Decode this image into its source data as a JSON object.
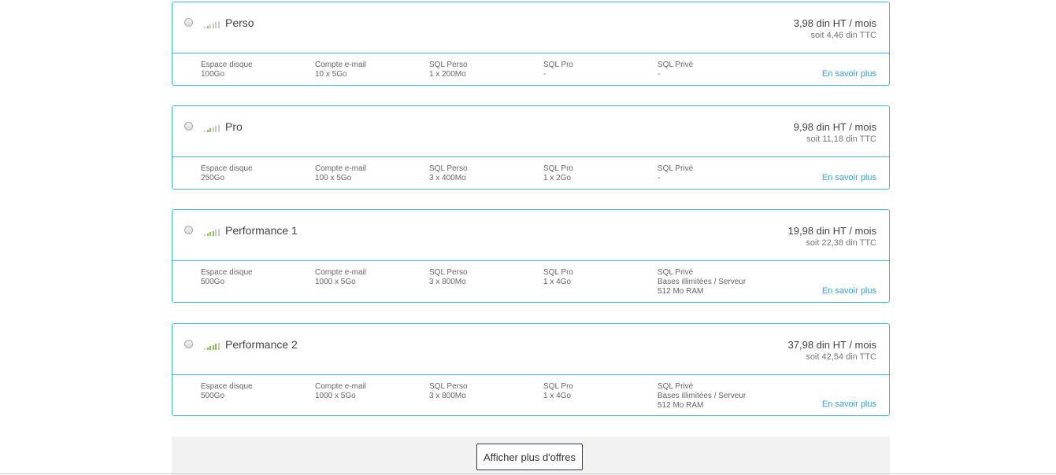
{
  "plans": [
    {
      "name": "Perso",
      "price_ht": "3,98 din HT / mois",
      "price_ttc": "soit 4,46 din TTC",
      "specs": [
        {
          "label": "Espace disque",
          "lines": [
            "100Go"
          ]
        },
        {
          "label": "Compte e-mail",
          "lines": [
            "10 x 5Go"
          ]
        },
        {
          "label": "SQL Perso",
          "lines": [
            "1 x 200Mo"
          ]
        },
        {
          "label": "SQL Pro",
          "lines": [
            "-"
          ]
        },
        {
          "label": "SQL Privé",
          "lines": [
            "-"
          ]
        }
      ],
      "more_label": "En savoir plus",
      "signal_level": 1
    },
    {
      "name": "Pro",
      "price_ht": "9,98 din HT / mois",
      "price_ttc": "soit 11,18 din TTC",
      "specs": [
        {
          "label": "Espace disque",
          "lines": [
            "250Go"
          ]
        },
        {
          "label": "Compte e-mail",
          "lines": [
            "100 x 5Go"
          ]
        },
        {
          "label": "SQL Perso",
          "lines": [
            "3 x 400Mo"
          ]
        },
        {
          "label": "SQL Pro",
          "lines": [
            "1 x 2Go"
          ]
        },
        {
          "label": "SQL Privé",
          "lines": [
            "-"
          ]
        }
      ],
      "more_label": "En savoir plus",
      "signal_level": 2
    },
    {
      "name": "Performance 1",
      "price_ht": "19,98 din HT / mois",
      "price_ttc": "soit 22,38 din TTC",
      "specs": [
        {
          "label": "Espace disque",
          "lines": [
            "500Go"
          ]
        },
        {
          "label": "Compte e-mail",
          "lines": [
            "1000 x 5Go"
          ]
        },
        {
          "label": "SQL Perso",
          "lines": [
            "3 x 800Mo"
          ]
        },
        {
          "label": "SQL Pro",
          "lines": [
            "1 x 4Go"
          ]
        },
        {
          "label": "SQL Privé",
          "lines": [
            "Bases illimitées / Serveur",
            "512 Mo RAM"
          ]
        }
      ],
      "more_label": "En savoir plus",
      "signal_level": 3
    },
    {
      "name": "Performance 2",
      "price_ht": "37,98 din HT / mois",
      "price_ttc": "soit 42,54 din TTC",
      "specs": [
        {
          "label": "Espace disque",
          "lines": [
            "500Go"
          ]
        },
        {
          "label": "Compte e-mail",
          "lines": [
            "1000 x 5Go"
          ]
        },
        {
          "label": "SQL Perso",
          "lines": [
            "3 x 800Mo"
          ]
        },
        {
          "label": "SQL Pro",
          "lines": [
            "1 x 4Go"
          ]
        },
        {
          "label": "SQL Privé",
          "lines": [
            "Bases illimitées / Serveur",
            "512 Mo RAM"
          ]
        }
      ],
      "more_label": "En savoir plus",
      "signal_level": 4
    }
  ],
  "footer": {
    "more_offers_label": "Afficher plus d'offres"
  },
  "colors": {
    "border": "#3fb7d9",
    "link": "#3a9fd0",
    "signal_active": "#8bc34a",
    "signal_inactive": "#c8c8c8"
  },
  "icons": {
    "radio": "radio-button-icon",
    "signal": "signal-strength-icon"
  }
}
